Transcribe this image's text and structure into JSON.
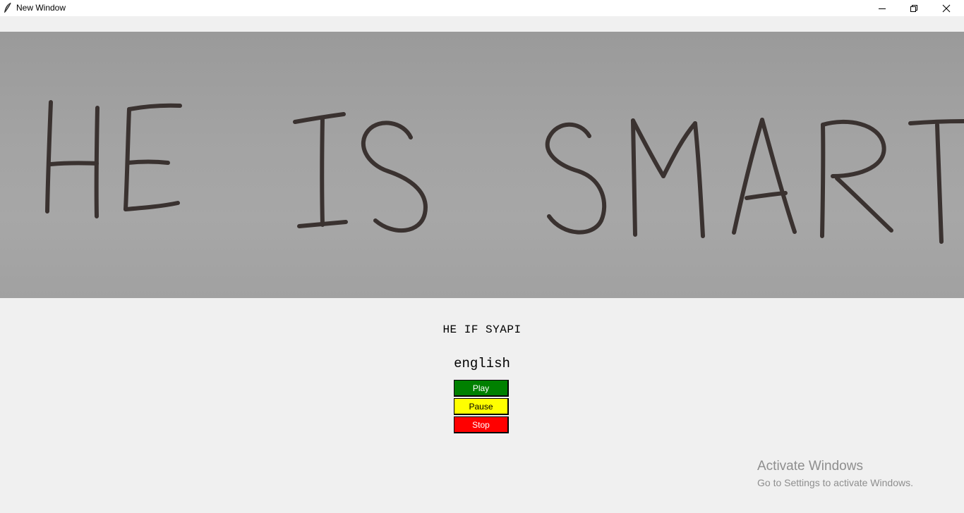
{
  "window": {
    "title": "New Window",
    "icons": {
      "app": "feather-icon",
      "minimize": "minimize-icon",
      "maximize": "restore-icon",
      "close": "close-icon"
    }
  },
  "photo": {
    "handwritten_text": "HE IS SMART"
  },
  "recognized_text": "HE IF SYAPI",
  "language": "english",
  "controls": {
    "play": {
      "label": "Play",
      "bg": "#008000",
      "fg": "#ffffff"
    },
    "pause": {
      "label": "Pause",
      "bg": "#ffff00",
      "fg": "#000000"
    },
    "stop": {
      "label": "Stop",
      "bg": "#ff0000",
      "fg": "#ffffff"
    }
  },
  "watermark": {
    "line1": "Activate Windows",
    "line2": "Go to Settings to activate Windows."
  }
}
